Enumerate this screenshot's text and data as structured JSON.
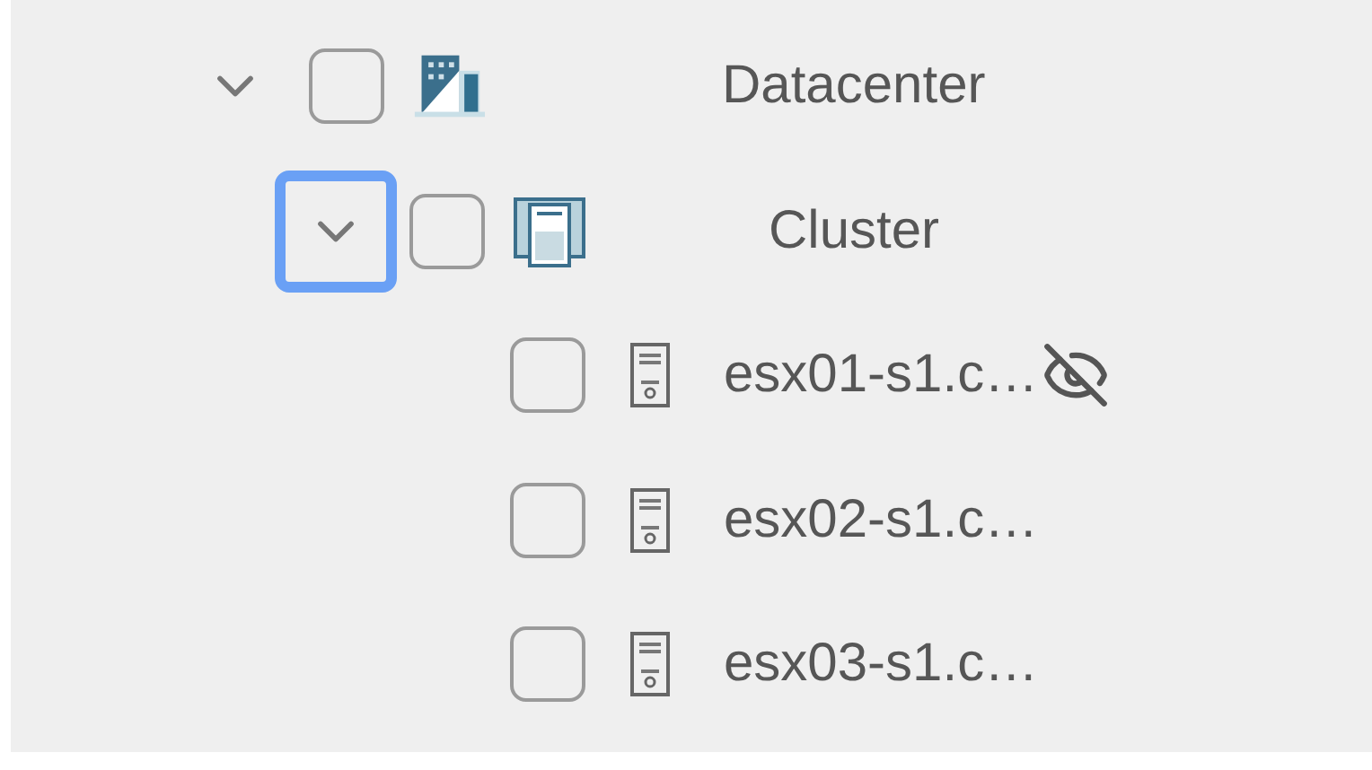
{
  "tree": [
    {
      "kind": "datacenter",
      "label": "Datacenter",
      "expanded": true,
      "focused": false,
      "checked": false,
      "children": [
        {
          "kind": "cluster",
          "label": "Cluster",
          "expanded": true,
          "focused": true,
          "checked": false,
          "children": [
            {
              "kind": "host",
              "label": "esx01-s1.c…",
              "checked": false,
              "hidden": true
            },
            {
              "kind": "host",
              "label": "esx02-s1.c…",
              "checked": false,
              "hidden": false
            },
            {
              "kind": "host",
              "label": "esx03-s1.c…",
              "checked": false,
              "hidden": false
            }
          ]
        }
      ]
    }
  ]
}
